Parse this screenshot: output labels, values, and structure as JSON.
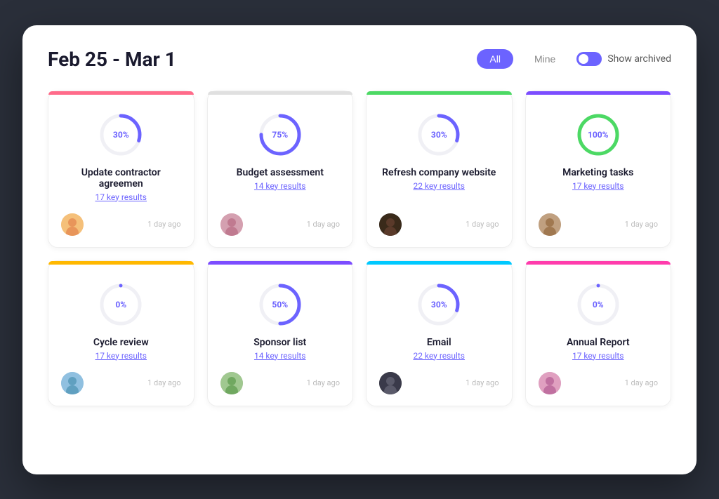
{
  "header": {
    "title": "Feb 25 - Mar 1",
    "filter_all": "All",
    "filter_mine": "Mine",
    "show_archived": "Show archived"
  },
  "cards": [
    {
      "id": "card-1",
      "title": "Update contractor agreemen",
      "key_results": "17 key results",
      "progress": 30,
      "time": "1 day ago",
      "bar_color": "#ff6b8a",
      "stroke_color": "#6c63ff",
      "avatar_class": "av1",
      "avatar_emoji": "👨"
    },
    {
      "id": "card-2",
      "title": "Budget assessment",
      "key_results": "14 key results",
      "progress": 75,
      "time": "1 day ago",
      "bar_color": "#e0e0e0",
      "stroke_color": "#6c63ff",
      "avatar_class": "av2",
      "avatar_emoji": "👩"
    },
    {
      "id": "card-3",
      "title": "Refresh company website",
      "key_results": "22 key results",
      "progress": 30,
      "time": "1 day ago",
      "bar_color": "#4cd964",
      "stroke_color": "#6c63ff",
      "avatar_class": "av3",
      "avatar_emoji": "👩"
    },
    {
      "id": "card-4",
      "title": "Marketing tasks",
      "key_results": "17 key results",
      "progress": 100,
      "time": "1 day ago",
      "bar_color": "#7c4dff",
      "stroke_color": "#4cd964",
      "avatar_class": "av4",
      "avatar_emoji": "👨"
    },
    {
      "id": "card-5",
      "title": "Cycle review",
      "key_results": "17 key results",
      "progress": 0,
      "time": "1 day ago",
      "bar_color": "#ffb800",
      "stroke_color": "#6c63ff",
      "avatar_class": "av5",
      "avatar_emoji": "👩"
    },
    {
      "id": "card-6",
      "title": "Sponsor list",
      "key_results": "14 key results",
      "progress": 50,
      "time": "1 day ago",
      "bar_color": "#7c4dff",
      "stroke_color": "#6c63ff",
      "avatar_class": "av6",
      "avatar_emoji": "👨"
    },
    {
      "id": "card-7",
      "title": "Email",
      "key_results": "22 key results",
      "progress": 30,
      "time": "1 day ago",
      "bar_color": "#00c9ff",
      "stroke_color": "#6c63ff",
      "avatar_class": "av7",
      "avatar_emoji": "👨"
    },
    {
      "id": "card-8",
      "title": "Annual Report",
      "key_results": "17 key results",
      "progress": 0,
      "time": "1 day ago",
      "bar_color": "#ff3cac",
      "stroke_color": "#6c63ff",
      "avatar_class": "av8",
      "avatar_emoji": "👩"
    }
  ]
}
